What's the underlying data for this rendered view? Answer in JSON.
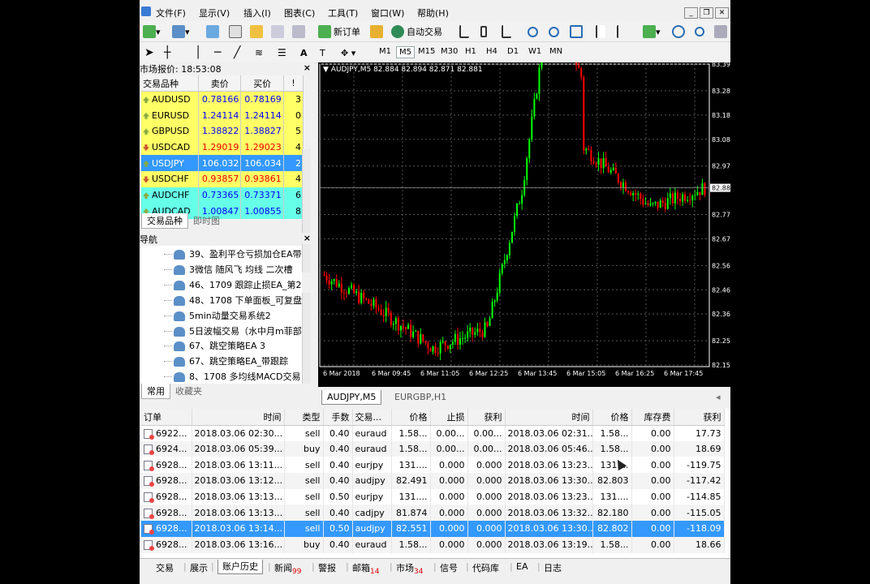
{
  "menu": [
    "文件(F)",
    "显示(V)",
    "插入(I)",
    "图表(C)",
    "工具(T)",
    "窗口(W)",
    "帮助(H)"
  ],
  "toolbar": {
    "new_order": "新订单",
    "auto_trade": "自动交易"
  },
  "timeframes": [
    "M1",
    "M5",
    "M15",
    "M30",
    "H1",
    "H4",
    "D1",
    "W1",
    "MN"
  ],
  "timeframe_selected": "M5",
  "market_watch": {
    "title": "市场报价: 18:53:08",
    "columns": [
      "交易品种",
      "卖价",
      "买价",
      "!"
    ],
    "rows": [
      {
        "symbol": "AUDUSD",
        "bid": "0.78166",
        "ask": "0.78169",
        "spread": "3",
        "dir": "up"
      },
      {
        "symbol": "EURUSD",
        "bid": "1.24114",
        "ask": "1.24114",
        "spread": "0",
        "dir": "up"
      },
      {
        "symbol": "GBPUSD",
        "bid": "1.38822",
        "ask": "1.38827",
        "spread": "5",
        "dir": "up"
      },
      {
        "symbol": "USDCAD",
        "bid": "1.29019",
        "ask": "1.29023",
        "spread": "4",
        "dir": "down"
      },
      {
        "symbol": "USDJPY",
        "bid": "106.032",
        "ask": "106.034",
        "spread": "2",
        "dir": "up"
      },
      {
        "symbol": "USDCHF",
        "bid": "0.93857",
        "ask": "0.93861",
        "spread": "4",
        "dir": "down"
      },
      {
        "symbol": "AUDCHF",
        "bid": "0.73365",
        "ask": "0.73371",
        "spread": "6",
        "dir": "up"
      },
      {
        "symbol": "AUDCAD",
        "bid": "1.00847",
        "ask": "1.00855",
        "spread": "8",
        "dir": "up"
      }
    ],
    "tabs": [
      "交易品种",
      "即时图"
    ]
  },
  "navigator": {
    "title": "导航",
    "items": [
      "39、盈利平仓亏损加仓EA带",
      "3微信 随风飞 均线 二次槽",
      "46、1709 跟踪止损EA_第2",
      "48、1708 下单面板_可复盘",
      "5min动量交易系统2",
      "5日波幅交易（水中月m菲部",
      "67、跳空策略EA 3",
      "67、跳空策略EA_带跟踪",
      "8、1708 多均线MACD交易"
    ],
    "tabs": [
      "常用",
      "收藏夹"
    ]
  },
  "chart": {
    "header": "AUDJPY,M5  82.884 82.894 82.871 82.881",
    "current_price": "82.88",
    "y_labels": [
      "83.39",
      "83.28",
      "83.18",
      "83.08",
      "82.97",
      "82.88",
      "82.77",
      "82.67",
      "82.56",
      "82.46",
      "82.36",
      "82.25",
      "82.15"
    ],
    "x_labels": [
      "6 Mar 2018",
      "6 Mar 09:45",
      "6 Mar 11:05",
      "6 Mar 12:25",
      "6 Mar 13:45",
      "6 Mar 15:05",
      "6 Mar 16:25",
      "6 Mar 17:45"
    ],
    "tabs": [
      "AUDJPY,M5",
      "EURGBP,H1"
    ],
    "up_color": "#00ff00",
    "down_color": "#ff0000"
  },
  "chart_data": {
    "type": "candlestick",
    "symbol": "AUDJPY",
    "timeframe": "M5",
    "ylim": [
      82.15,
      83.39
    ],
    "x": [
      "6 Mar 2018",
      "6 Mar 09:45",
      "6 Mar 11:05",
      "6 Mar 12:25",
      "6 Mar 13:45",
      "6 Mar 15:05",
      "6 Mar 16:25",
      "6 Mar 17:45"
    ],
    "close_approx": [
      82.52,
      82.38,
      82.22,
      82.3,
      83.2,
      83.0,
      82.8,
      82.88
    ],
    "last": {
      "open": "82.884",
      "high": "82.894",
      "low": "82.871",
      "close": "82.881"
    }
  },
  "terminal": {
    "columns": [
      "订单",
      "时间",
      "类型",
      "手数",
      "交易...",
      "价格",
      "止损",
      "获利",
      "时间",
      "价格",
      "库存费",
      "获利"
    ],
    "rows": [
      [
        "6922...",
        "2018.03.06 02:30...",
        "sell",
        "0.40",
        "euraud",
        "1.58...",
        "0.00...",
        "0.00...",
        "2018.03.06 02:31...",
        "1.58...",
        "0.00",
        "17.73"
      ],
      [
        "6924...",
        "2018.03.06 05:39...",
        "buy",
        "0.40",
        "euraud",
        "1.58...",
        "0.00...",
        "0.00...",
        "2018.03.06 05:46...",
        "1.58...",
        "0.00",
        "18.69"
      ],
      [
        "6928...",
        "2018.03.06 13:11...",
        "sell",
        "0.40",
        "eurjpy",
        "131....",
        "0.000",
        "0.000",
        "2018.03.06 13:23...",
        "131....",
        "0.00",
        "-119.75"
      ],
      [
        "6928...",
        "2018.03.06 13:12...",
        "sell",
        "0.40",
        "audjpy",
        "82.491",
        "0.000",
        "0.000",
        "2018.03.06 13:30...",
        "82.803",
        "0.00",
        "-117.42"
      ],
      [
        "6928...",
        "2018.03.06 13:13...",
        "sell",
        "0.50",
        "eurjpy",
        "131....",
        "0.000",
        "0.000",
        "2018.03.06 13:23...",
        "131....",
        "0.00",
        "-114.85"
      ],
      [
        "6928...",
        "2018.03.06 13:13...",
        "sell",
        "0.40",
        "cadjpy",
        "81.874",
        "0.000",
        "0.000",
        "2018.03.06 13:32...",
        "82.180",
        "0.00",
        "-115.05"
      ],
      [
        "6928...",
        "2018.03.06 13:14...",
        "sell",
        "0.50",
        "audjpy",
        "82.551",
        "0.000",
        "0.000",
        "2018.03.06 13:30...",
        "82.802",
        "0.00",
        "-118.09"
      ],
      [
        "6928...",
        "2018.03.06 13:16...",
        "buy",
        "0.40",
        "euraud",
        "1.58...",
        "0.000",
        "0.000",
        "2018.03.06 13:19...",
        "1.58...",
        "0.00",
        "18.66"
      ]
    ],
    "selected_row": 6,
    "tabs": [
      {
        "label": "交易",
        "badge": ""
      },
      {
        "label": "展示",
        "badge": ""
      },
      {
        "label": "账户历史",
        "badge": ""
      },
      {
        "label": "新闻",
        "badge": "99"
      },
      {
        "label": "警报",
        "badge": ""
      },
      {
        "label": "邮箱",
        "badge": "14"
      },
      {
        "label": "市场",
        "badge": "34"
      },
      {
        "label": "信号",
        "badge": ""
      },
      {
        "label": "代码库",
        "badge": ""
      },
      {
        "label": "EA",
        "badge": ""
      },
      {
        "label": "日志",
        "badge": ""
      }
    ],
    "active_tab": 2
  }
}
